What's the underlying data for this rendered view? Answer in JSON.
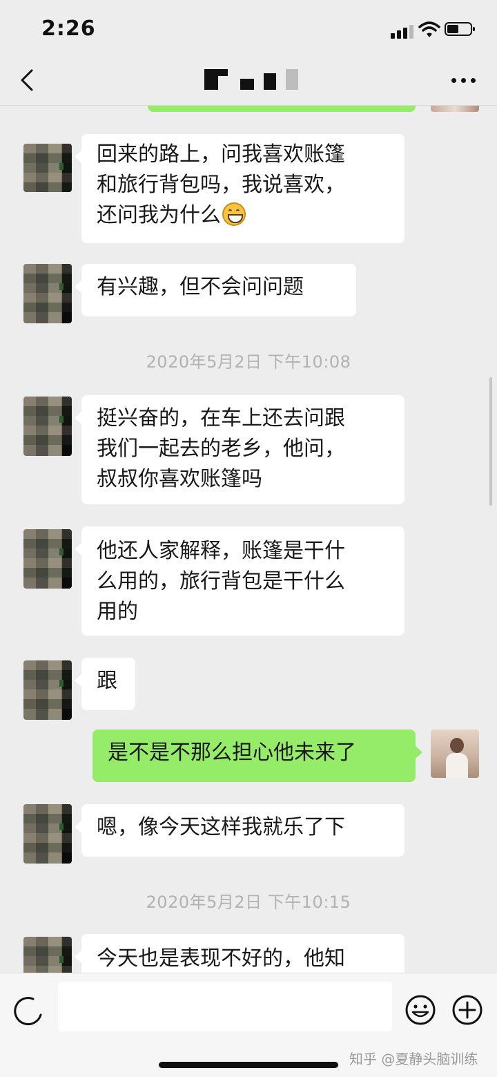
{
  "status_bar": {
    "time": "2:26"
  },
  "chat": {
    "messages": [
      {
        "sender": "other",
        "lines": [
          "回来的路上，问我喜欢账篷",
          "和旅行背包吗，我说喜欢，",
          "还问我为什么"
        ],
        "trailing_emoji": "grinning-face"
      },
      {
        "sender": "other",
        "lines": [
          "有兴趣，但不会问问题"
        ]
      },
      {
        "timestamp": "2020年5月2日 下午10:08"
      },
      {
        "sender": "other",
        "lines": [
          "挺兴奋的，在车上还去问跟",
          "我们一起去的老乡，他问，",
          "叔叔你喜欢账篷吗"
        ]
      },
      {
        "sender": "other",
        "lines": [
          "他还人家解释，账篷是干什",
          "么用的，旅行背包是干什么",
          "用的"
        ]
      },
      {
        "sender": "other",
        "lines": [
          "跟"
        ]
      },
      {
        "sender": "self",
        "lines": [
          "是不是不那么担心他未来了"
        ]
      },
      {
        "sender": "other",
        "lines": [
          "嗯，像今天这样我就乐了下"
        ]
      },
      {
        "timestamp": "2020年5月2日 下午10:15"
      },
      {
        "sender": "other",
        "lines": [
          "今天也是表现不好的，他知"
        ]
      }
    ]
  },
  "bottom": {
    "watermark": "知乎 @夏静头脑训练"
  },
  "colors": {
    "background": "#ededed",
    "self_bubble": "#95ec69",
    "other_bubble": "#ffffff",
    "timestamp_text": "#b2b2b2"
  },
  "icons": [
    "back-icon",
    "more-icon",
    "voice-icon",
    "emoji-icon",
    "plus-icon",
    "signal-icon",
    "wifi-icon",
    "battery-icon"
  ]
}
